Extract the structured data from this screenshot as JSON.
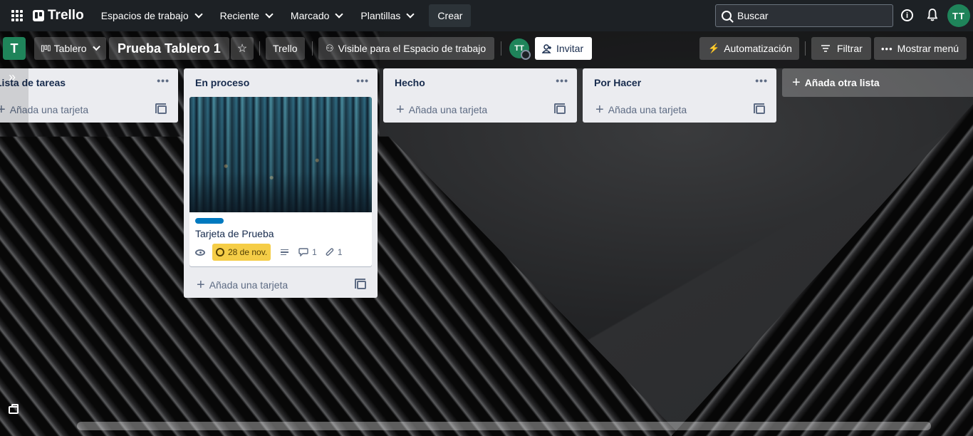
{
  "topnav": {
    "brand": "Trello",
    "menus": [
      {
        "label": "Espacios de trabajo"
      },
      {
        "label": "Reciente"
      },
      {
        "label": "Marcado"
      },
      {
        "label": "Plantillas"
      }
    ],
    "create_label": "Crear",
    "search_placeholder": "Buscar",
    "avatar_initials": "TT"
  },
  "board": {
    "workspace_initial": "T",
    "view_label": "Tablero",
    "title": "Prueba Tablero 1",
    "workspace_label": "Trello",
    "visibility_label": "Visible para el Espacio de trabajo",
    "member_initials": "TT",
    "invite_label": "Invitar",
    "automation_label": "Automatización",
    "filter_label": "Filtrar",
    "menu_label": "Mostrar menú"
  },
  "lists": [
    {
      "title": "Lista de tareas",
      "add_card_label": "Añada una tarjeta"
    },
    {
      "title": "En proceso",
      "add_card_label": "Añada una tarjeta",
      "card": {
        "title": "Tarjeta de Prueba",
        "label_color": "#0079bf",
        "due_date": "28 de nov.",
        "comments": "1",
        "attachments": "1"
      }
    },
    {
      "title": "Hecho",
      "add_card_label": "Añada una tarjeta"
    },
    {
      "title": "Por Hacer",
      "add_card_label": "Añada una tarjeta"
    }
  ],
  "add_list_label": "Añada otra lista",
  "colors": {
    "topbar": "#1d2125",
    "avatar": "#1f845a",
    "due_badge": "#f5cd47",
    "list_bg": "#ebecf0"
  }
}
